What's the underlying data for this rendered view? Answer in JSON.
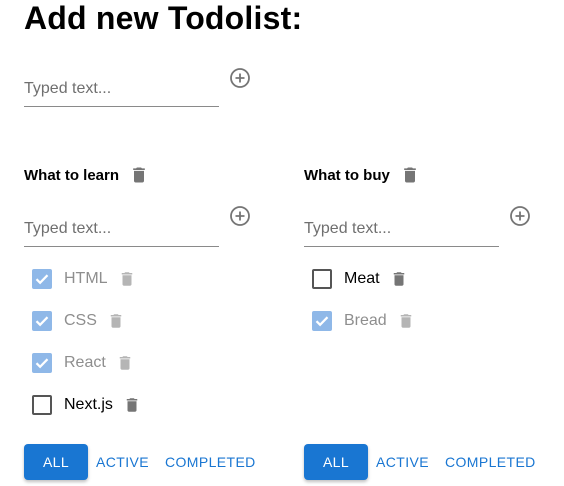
{
  "page": {
    "title": "Add new Todolist:"
  },
  "new_list": {
    "placeholder": "Typed text..."
  },
  "todolists": [
    {
      "title": "What to learn",
      "placeholder": "Typed text...",
      "tasks": [
        {
          "label": "HTML",
          "done": true
        },
        {
          "label": "CSS",
          "done": true
        },
        {
          "label": "React",
          "done": true
        },
        {
          "label": "Next.js",
          "done": false
        }
      ],
      "filters": [
        "ALL",
        "ACTIVE",
        "COMPLETED"
      ],
      "active_filter": "ALL"
    },
    {
      "title": "What to buy",
      "placeholder": "Typed text...",
      "tasks": [
        {
          "label": "Meat",
          "done": false
        },
        {
          "label": "Bread",
          "done": true
        }
      ],
      "filters": [
        "ALL",
        "ACTIVE",
        "COMPLETED"
      ],
      "active_filter": "ALL"
    }
  ],
  "colors": {
    "accent": "#1976d2",
    "checked": "#8fb8e8",
    "icon": "#757575",
    "icon_muted": "#b5b5b5"
  },
  "icons": {
    "add": "add-circle-outline-icon",
    "delete": "trash-icon",
    "check": "checkmark-icon"
  }
}
